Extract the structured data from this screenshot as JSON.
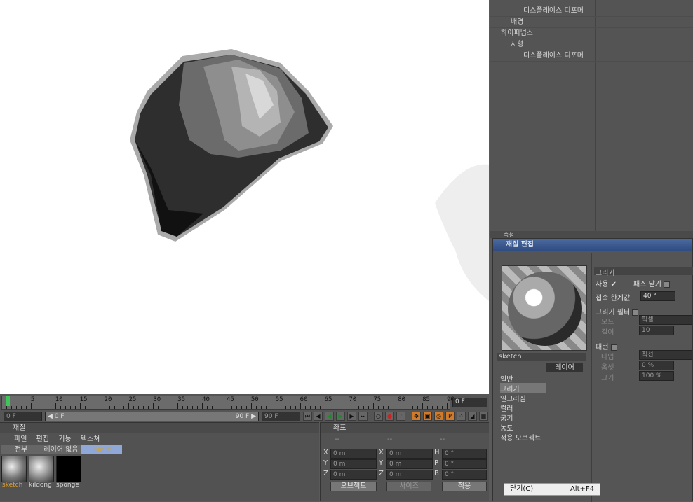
{
  "timeline": {
    "ticks": [
      "0",
      "5",
      "10",
      "15",
      "20",
      "25",
      "30",
      "35",
      "40",
      "45",
      "50",
      "55",
      "60",
      "65",
      "70",
      "75",
      "80",
      "85",
      "90"
    ],
    "current_frame": "0 F",
    "start_field": "0 F",
    "range_start": "◀ 0 F",
    "range_end": "90 F ▶",
    "end_field": "90 F"
  },
  "material_panel": {
    "title": "재질",
    "menu": [
      "파일",
      "편집",
      "기능",
      "텍스쳐"
    ],
    "filters": [
      "전부",
      "레이어 없음",
      "skete"
    ],
    "swatches": [
      {
        "name": "sketch",
        "color": "#888"
      },
      {
        "name": "kildong",
        "color": "#999"
      },
      {
        "name": "sponge",
        "color": "#000"
      }
    ]
  },
  "coord_panel": {
    "title": "좌표",
    "headers": [
      "--",
      "--",
      "--"
    ],
    "rows": [
      [
        "X",
        "0 m",
        "X",
        "0 m",
        "H",
        "0 °"
      ],
      [
        "Y",
        "0 m",
        "Y",
        "0 m",
        "P",
        "0 °"
      ],
      [
        "Z",
        "0 m",
        "Z",
        "0 m",
        "B",
        "0 °"
      ]
    ],
    "mode_object": "오브젝트",
    "mode_size": "사이즈",
    "apply": "적용"
  },
  "objects": [
    {
      "name": "디스플레이스 디포머",
      "indent": 2
    },
    {
      "name": "배경",
      "indent": 1
    },
    {
      "name": "하이퍼넙스",
      "indent": 0
    },
    {
      "name": "지형",
      "indent": 1
    },
    {
      "name": "디스플레이스 디포머",
      "indent": 2
    }
  ],
  "attributes": {
    "title": "속성"
  },
  "material_editor": {
    "title": "재질 편집",
    "material_name": "sketch",
    "layer_button": "레이어",
    "nav": [
      "일반",
      "그리기",
      "일그러짐",
      "컬러",
      "굵기",
      "농도",
      "적용 오브젝트"
    ],
    "selected_nav": "그리기",
    "section_title": "그리기",
    "props": {
      "use": "사용",
      "close_path": "패스 닫기",
      "threshold_label": "접속 한계값",
      "threshold": "40 °",
      "draw_filter": "그리기 필터",
      "mode_label": "모드",
      "mode_value": "픽셀",
      "length_label": "길이",
      "length_value": "10",
      "pattern": "패턴",
      "type_label": "타입",
      "type_value": "직선",
      "offset_label": "옵셋",
      "offset_value": "0 %",
      "size_label": "크기",
      "size_value": "100 %"
    }
  },
  "context_menu": {
    "close": "닫기(C)",
    "shortcut": "Alt+F4"
  }
}
